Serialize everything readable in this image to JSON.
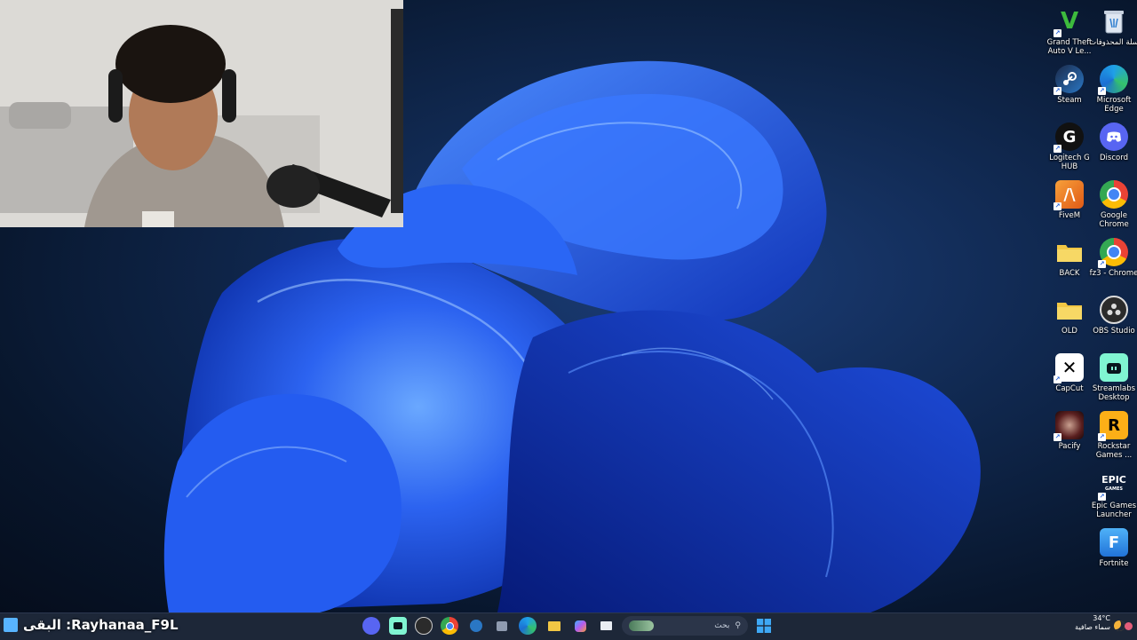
{
  "overlay": {
    "text": "البقى :Rayhanaa_F9L"
  },
  "desktop_icons": [
    {
      "label": "سلة المحذوفات",
      "icon": "recycle-bin-icon"
    },
    {
      "label": "Grand Theft Auto V Le...",
      "icon": "gta-v-icon"
    },
    {
      "label": "Microsoft Edge",
      "icon": "edge-icon"
    },
    {
      "label": "Steam",
      "icon": "steam-icon"
    },
    {
      "label": "Discord",
      "icon": "discord-icon"
    },
    {
      "label": "Logitech G HUB",
      "icon": "logitech-icon"
    },
    {
      "label": "Google Chrome",
      "icon": "chrome-icon"
    },
    {
      "label": "FiveM",
      "icon": "fivem-icon"
    },
    {
      "label": "fz3 - Chrome",
      "icon": "chrome-profile-icon"
    },
    {
      "label": "BACK",
      "icon": "folder-icon"
    },
    {
      "label": "OBS Studio",
      "icon": "obs-icon"
    },
    {
      "label": "OLD",
      "icon": "folder-icon"
    },
    {
      "label": "Streamlabs Desktop",
      "icon": "streamlabs-icon"
    },
    {
      "label": "CapCut",
      "icon": "capcut-icon"
    },
    {
      "label": "Rockstar Games ...",
      "icon": "rockstar-icon"
    },
    {
      "label": "Pacify",
      "icon": "pacify-icon"
    },
    {
      "label": "Epic Games Launcher",
      "icon": "epic-games-icon"
    },
    {
      "label": "Fortnite",
      "icon": "fortnite-icon"
    }
  ],
  "taskbar": {
    "search_placeholder": "بحث",
    "apps": [
      "discord-icon",
      "streamlabs-icon",
      "obs-icon",
      "chrome-icon",
      "steam-icon",
      "store-icon",
      "edge-icon",
      "file-explorer-icon",
      "copilot-icon",
      "app-window-icon"
    ]
  },
  "weather": {
    "temp": "34°C",
    "condition": "سماء صافية"
  },
  "colors": {
    "accent": "#2a6dfb",
    "taskbar": "#1d2738"
  }
}
